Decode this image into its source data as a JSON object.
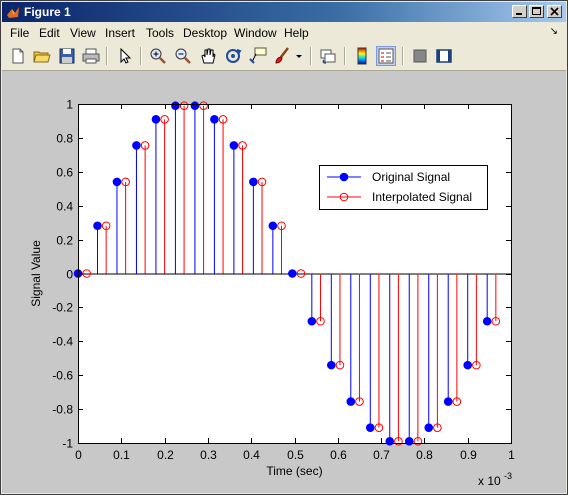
{
  "window": {
    "title": "Figure 1",
    "titlebar_buttons": [
      "minimize",
      "maximize",
      "close"
    ]
  },
  "menubar": {
    "items": [
      "File",
      "Edit",
      "View",
      "Insert",
      "Tools",
      "Desktop",
      "Window",
      "Help"
    ]
  },
  "toolbar": {
    "tools": [
      {
        "name": "new-figure-icon"
      },
      {
        "name": "open-file-icon"
      },
      {
        "name": "save-icon"
      },
      {
        "name": "print-icon"
      },
      {
        "name": "select-arrow-icon"
      },
      {
        "name": "zoom-in-icon"
      },
      {
        "name": "zoom-out-icon"
      },
      {
        "name": "pan-hand-icon"
      },
      {
        "name": "rotate-3d-icon"
      },
      {
        "name": "data-cursor-icon"
      },
      {
        "name": "brush-icon"
      },
      {
        "name": "link-plot-icon"
      },
      {
        "name": "colorbar-icon"
      },
      {
        "name": "legend-icon"
      },
      {
        "name": "hide-plot-tools-icon"
      },
      {
        "name": "show-plot-tools-icon"
      }
    ]
  },
  "chart_data": {
    "type": "stem",
    "xlabel": "Time (sec)",
    "ylabel": "Signal Value",
    "x_multiplier_label": "x 10",
    "x_multiplier_exponent": "-3",
    "xlim": [
      0,
      1
    ],
    "ylim": [
      -1,
      1
    ],
    "xticks": [
      0,
      0.1,
      0.2,
      0.3,
      0.4,
      0.5,
      0.6,
      0.7,
      0.8,
      0.9,
      1
    ],
    "xtick_labels": [
      "0",
      "0.1",
      "0.2",
      "0.3",
      "0.4",
      "0.5",
      "0.6",
      "0.7",
      "0.8",
      "0.9",
      "1"
    ],
    "yticks": [
      -1,
      -0.8,
      -0.6,
      -0.4,
      -0.2,
      0,
      0.2,
      0.4,
      0.6,
      0.8,
      1
    ],
    "ytick_labels": [
      "-1",
      "-0.8",
      "-0.6",
      "-0.4",
      "-0.2",
      "0",
      "0.2",
      "0.4",
      "0.6",
      "0.8",
      "1"
    ],
    "legend_position": "upper-right",
    "series": [
      {
        "name": "Original Signal",
        "color": "#0000ff",
        "marker": "filled-circle",
        "x": [
          0,
          0.045,
          0.09,
          0.135,
          0.18,
          0.225,
          0.27,
          0.315,
          0.36,
          0.405,
          0.45,
          0.495,
          0.54,
          0.585,
          0.63,
          0.675,
          0.72,
          0.765,
          0.81,
          0.855,
          0.9,
          0.945
        ],
        "values": [
          0,
          0.2817,
          0.5406,
          0.7557,
          0.9096,
          0.9898,
          0.9898,
          0.9096,
          0.7557,
          0.5406,
          0.2817,
          0,
          -0.2817,
          -0.5406,
          -0.7557,
          -0.9096,
          -0.9898,
          -0.9898,
          -0.9096,
          -0.7557,
          -0.5406,
          -0.2817
        ]
      },
      {
        "name": "Interpolated Signal",
        "color": "#ff0000",
        "marker": "open-circle",
        "x": [
          0.02,
          0.065,
          0.11,
          0.155,
          0.2,
          0.245,
          0.29,
          0.335,
          0.38,
          0.425,
          0.47,
          0.515,
          0.56,
          0.605,
          0.65,
          0.695,
          0.74,
          0.785,
          0.83,
          0.875,
          0.92,
          0.965
        ],
        "values": [
          0,
          0.2817,
          0.5406,
          0.7557,
          0.9096,
          0.9898,
          0.9898,
          0.9096,
          0.7557,
          0.5406,
          0.2817,
          0,
          -0.2817,
          -0.5406,
          -0.7557,
          -0.9096,
          -0.9898,
          -0.9898,
          -0.9096,
          -0.7557,
          -0.5406,
          -0.2817
        ]
      }
    ]
  }
}
